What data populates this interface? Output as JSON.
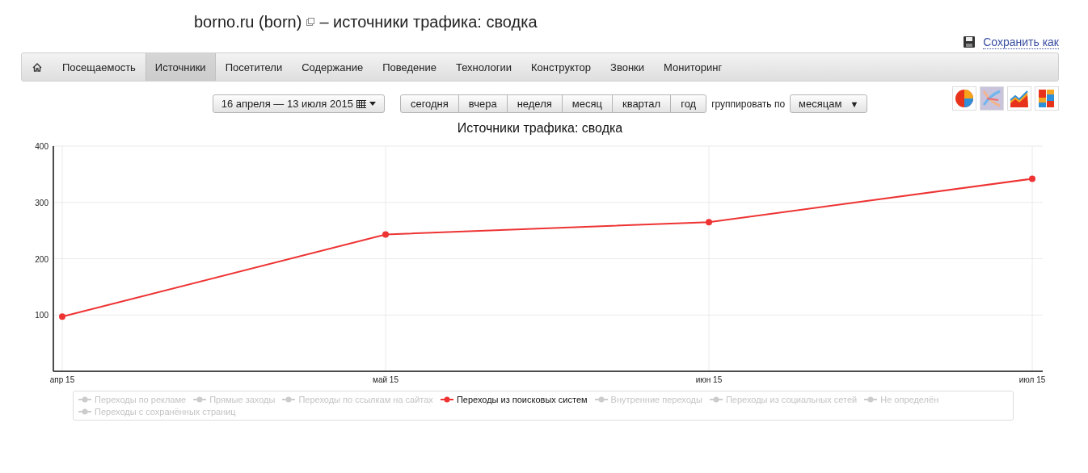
{
  "header": {
    "site": "borno.ru (born)",
    "title_rest": "– источники трафика: сводка",
    "save_link": "Сохранить как"
  },
  "nav": [
    {
      "kind": "home",
      "selected": false
    },
    {
      "label": "Посещаемость",
      "selected": false
    },
    {
      "label": "Источники",
      "selected": true
    },
    {
      "label": "Посетители",
      "selected": false
    },
    {
      "label": "Содержание",
      "selected": false
    },
    {
      "label": "Поведение",
      "selected": false
    },
    {
      "label": "Технологии",
      "selected": false
    },
    {
      "label": "Конструктор",
      "selected": false
    },
    {
      "label": "Звонки",
      "selected": false
    },
    {
      "label": "Мониторинг",
      "selected": false
    }
  ],
  "toolbar": {
    "date_range": "16 апреля — 13 июля 2015",
    "periods": [
      "сегодня",
      "вчера",
      "неделя",
      "месяц",
      "квартал",
      "год"
    ],
    "group_label": "группировать по",
    "group_value": "месяцам",
    "dropdown_glyph": "▼"
  },
  "chart_types": [
    {
      "kind": "pie",
      "selected": false
    },
    {
      "kind": "line",
      "selected": true
    },
    {
      "kind": "area",
      "selected": false
    },
    {
      "kind": "stacked",
      "selected": false
    }
  ],
  "chart": {
    "chart_data": {
      "type": "line",
      "title": "Источники трафика: сводка",
      "categories": [
        "апр 15",
        "май 15",
        "июн 15",
        "июл 15"
      ],
      "series": [
        {
          "name": "Переходы из поисковых систем",
          "color": "#ee3333",
          "marker": "circle",
          "values": [
            97,
            243,
            265,
            342
          ]
        }
      ],
      "grid": true,
      "ylim": [
        0,
        400
      ],
      "yticks": [
        100,
        200,
        300,
        400
      ]
    }
  },
  "legend": [
    {
      "label": "Переходы по рекламе",
      "selected": false
    },
    {
      "label": "Прямые заходы",
      "selected": false
    },
    {
      "label": "Переходы по ссылкам на сайтах",
      "selected": false
    },
    {
      "kind": "series",
      "selected": true
    },
    {
      "label": "Внутренние переходы",
      "selected": false
    },
    {
      "label": "Переходы из социальных сетей",
      "selected": false
    },
    {
      "label": "Не определён",
      "selected": false
    },
    {
      "label": "Переходы с сохранённых страниц",
      "selected": false
    }
  ]
}
